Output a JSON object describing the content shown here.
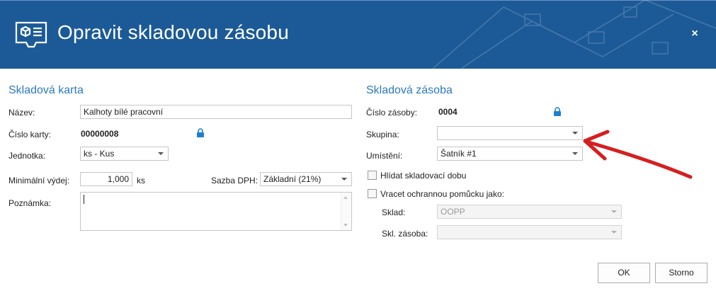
{
  "dialog": {
    "title": "Opravit skladovou zásobu",
    "close_glyph": "×",
    "header_color": "#1c5a97",
    "accent_color": "#2a7ac1"
  },
  "left": {
    "section_title": "Skladová karta",
    "nazev_label": "Název:",
    "nazev_value": "Kalhoty bílé pracovní",
    "cislo_karty_label": "Číslo karty:",
    "cislo_karty_value": "00000008",
    "jednotka_label": "Jednotka:",
    "jednotka_value": "ks - Kus",
    "min_vydej_label": "Minimální výdej:",
    "min_vydej_value": "1,000",
    "min_vydej_unit": "ks",
    "sazba_dph_label": "Sazba DPH:",
    "sazba_dph_value": "Základní (21%)",
    "poznamka_label": "Poznámka:",
    "poznamka_value": ""
  },
  "right": {
    "section_title": "Skladová zásoba",
    "cislo_zasoby_label": "Číslo zásoby:",
    "cislo_zasoby_value": "0004",
    "skupina_label": "Skupina:",
    "skupina_value": "",
    "umisteni_label": "Umístění:",
    "umisteni_value": "Šatník #1",
    "hlidat_label": "Hlídat skladovací dobu",
    "hlidat_checked": false,
    "vracet_label": "Vracet ochrannou pomůcku jako:",
    "vracet_checked": false,
    "sklad_label": "Sklad:",
    "sklad_value": "OOPP",
    "skl_zasoba_label": "Skl. zásoba:",
    "skl_zasoba_value": ""
  },
  "buttons": {
    "ok": "OK",
    "storno": "Storno"
  },
  "icons": {
    "title": "stock-card-icon",
    "lock": "lock-icon",
    "annotation": "red-arrow"
  },
  "annotation_color": "#d51f1f"
}
